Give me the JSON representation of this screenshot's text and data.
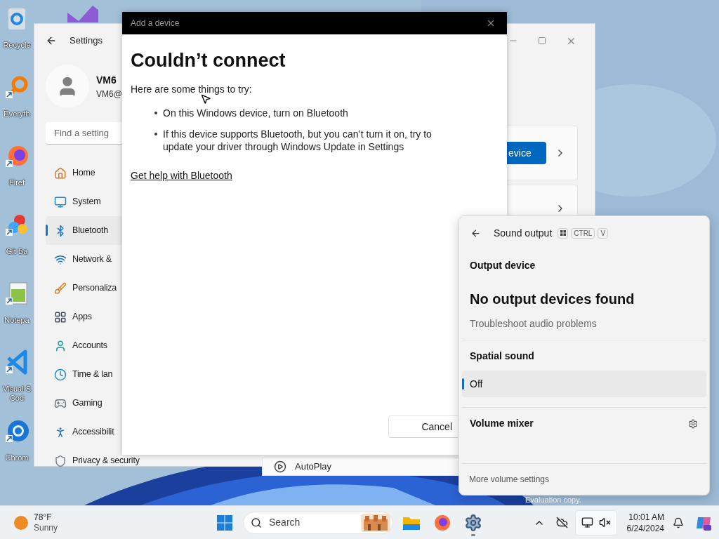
{
  "desktop": {
    "icons": [
      {
        "kind": "recycle",
        "label": "Recycle"
      },
      {
        "kind": "everything",
        "label": "Everyth"
      },
      {
        "kind": "firefox",
        "label": "Firef"
      },
      {
        "kind": "git",
        "label": "Git Ba"
      },
      {
        "kind": "notepad",
        "label": "Notepa"
      },
      {
        "kind": "vscode",
        "label": "Visual S\nCod"
      },
      {
        "kind": "chrome",
        "label": "Chrom"
      }
    ],
    "watermark": "Evaluation copy."
  },
  "settings": {
    "title": "Settings",
    "user": {
      "name": "VM6",
      "email": "VM6@"
    },
    "search": {
      "placeholder": "Find a setting"
    },
    "nav": [
      {
        "kind": "home",
        "label": "Home",
        "selected": false
      },
      {
        "kind": "system",
        "label": "System",
        "selected": false
      },
      {
        "kind": "bluetooth",
        "label": "Bluetooth",
        "selected": true
      },
      {
        "kind": "network",
        "label": "Network &",
        "selected": false
      },
      {
        "kind": "personalization",
        "label": "Personaliza",
        "selected": false
      },
      {
        "kind": "apps",
        "label": "Apps",
        "selected": false
      },
      {
        "kind": "accounts",
        "label": "Accounts",
        "selected": false
      },
      {
        "kind": "time",
        "label": "Time & lan",
        "selected": false
      },
      {
        "kind": "gaming",
        "label": "Gaming",
        "selected": false
      },
      {
        "kind": "accessibility",
        "label": "Accessibilit",
        "selected": false
      },
      {
        "kind": "privacy",
        "label": "Privacy & security",
        "selected": false
      }
    ],
    "device_button": "evice",
    "autoplay": "AutoPlay"
  },
  "dialog": {
    "title": "Add a device",
    "heading": "Couldn’t connect",
    "intro": "Here are some things to try:",
    "tips": [
      "On this Windows device, turn on Bluetooth",
      "If this device supports Bluetooth, but you can’t turn it on, try to update your driver through Windows Update in Settings"
    ],
    "link": "Get help with Bluetooth",
    "cancel": "Cancel"
  },
  "flyout": {
    "title": "Sound output",
    "keys": [
      "CTRL",
      "V"
    ],
    "output_heading": "Output device",
    "no_devices": "No output devices found",
    "troubleshoot": "Troubleshoot audio problems",
    "spatial_heading": "Spatial sound",
    "spatial_options": [
      {
        "label": "Off",
        "selected": true
      }
    ],
    "mixer_heading": "Volume mixer",
    "more": "More volume settings"
  },
  "taskbar": {
    "weather": {
      "temp": "78°F",
      "condition": "Sunny"
    },
    "search": {
      "placeholder": "Search"
    },
    "apps": [
      {
        "kind": "start",
        "running": false
      },
      {
        "kind": "explorer",
        "running": false
      },
      {
        "kind": "firefox",
        "running": false
      },
      {
        "kind": "settings",
        "running": true
      }
    ],
    "time": "10:01 AM",
    "date": "6/24/2024"
  }
}
